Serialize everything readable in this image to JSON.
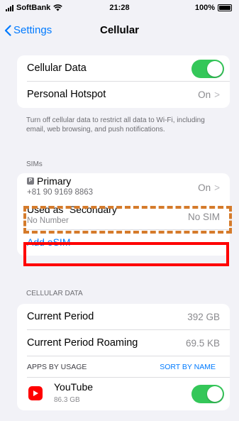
{
  "status_bar": {
    "carrier": "SoftBank",
    "time": "21:28",
    "battery": "100%"
  },
  "nav": {
    "back_label": "Settings",
    "title": "Cellular"
  },
  "group1": {
    "cellular_data_label": "Cellular Data",
    "cellular_data_on": true,
    "hotspot_label": "Personal Hotspot",
    "hotspot_value": "On"
  },
  "footnote": "Turn off cellular data to restrict all data to Wi-Fi, including email, web browsing, and push notifications.",
  "sims": {
    "header": "SIMs",
    "primary": {
      "badge": "P",
      "name": "Primary",
      "number": "+81 90 9169 8863",
      "value": "On"
    },
    "secondary": {
      "name": "Used as “Secondary”",
      "number": "No Number",
      "value": "No SIM"
    },
    "add_esim": "Add eSIM"
  },
  "usage": {
    "header": "CELLULAR DATA",
    "current_period_label": "Current Period",
    "current_period_value": "392 GB",
    "roaming_label": "Current Period Roaming",
    "roaming_value": "69.5 KB",
    "apps_by_usage": "APPS BY USAGE",
    "sort_by": "SORT BY NAME",
    "apps": [
      {
        "name": "YouTube",
        "size": "86.3 GB",
        "icon": "youtube-icon",
        "enabled": true
      }
    ]
  },
  "colors": {
    "accent": "#007aff",
    "toggle_on": "#34c759",
    "annotation_red": "#ff0000",
    "annotation_orange": "#d57b2b"
  }
}
